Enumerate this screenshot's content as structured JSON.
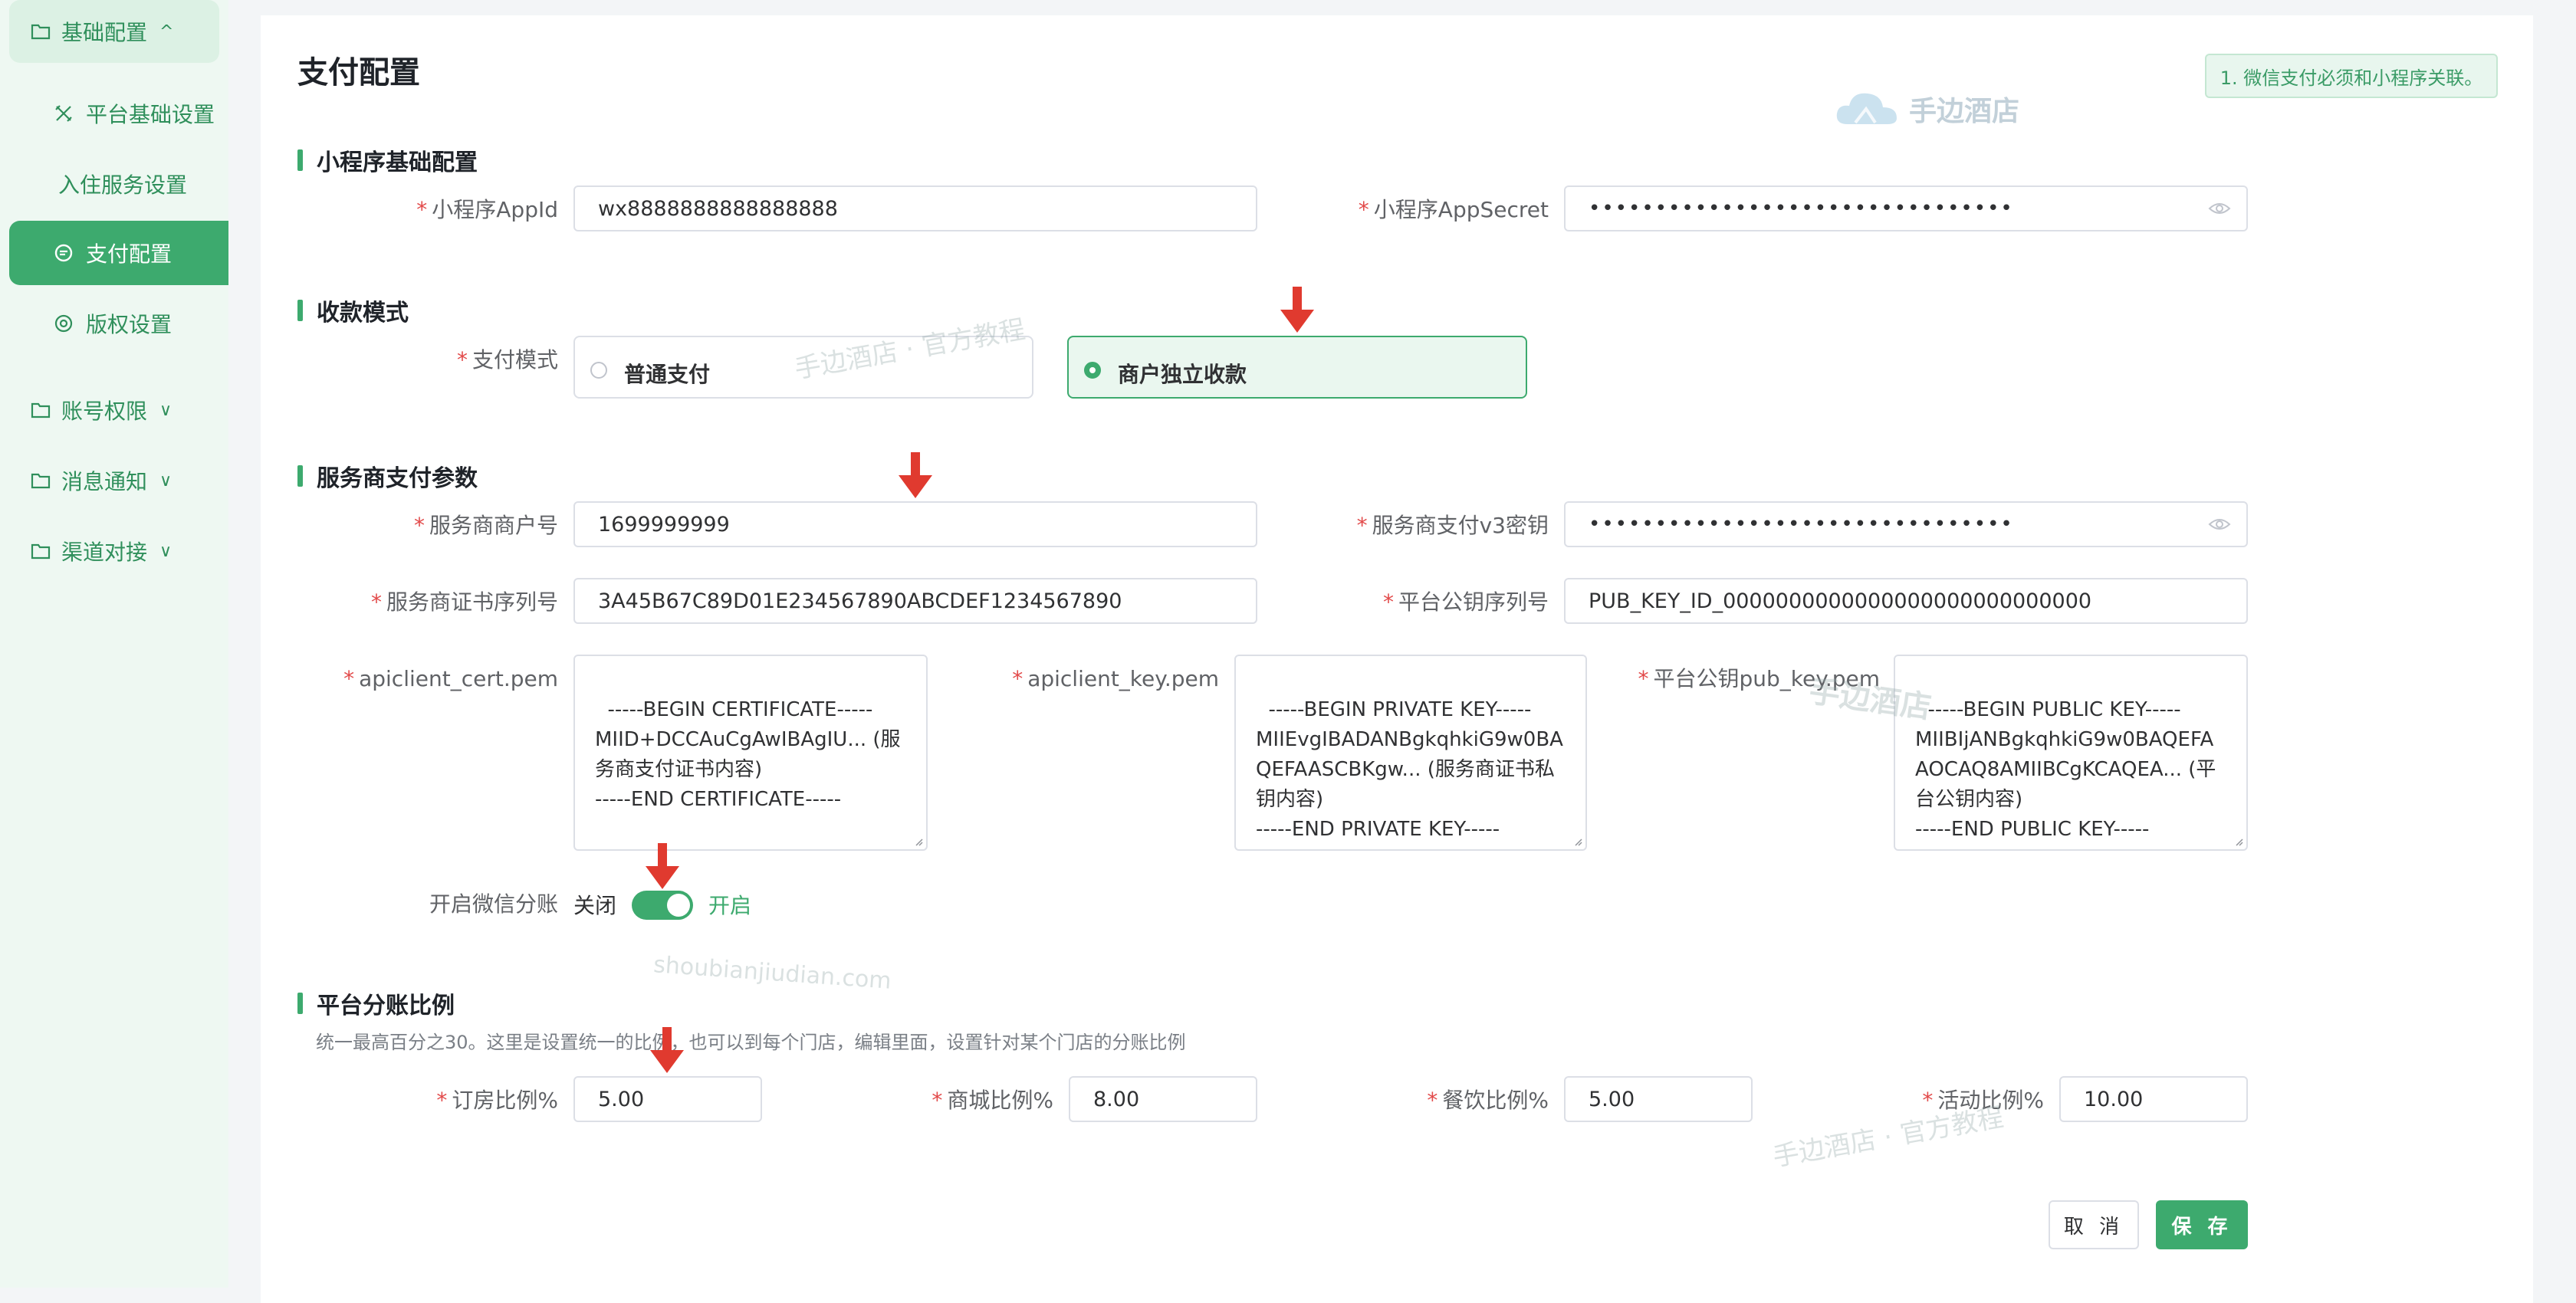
{
  "sidebar": {
    "groups": [
      {
        "label": "基础配置",
        "chevron": "^",
        "icon": "folder-icon"
      },
      {
        "label": "账号权限",
        "chevron": "∨",
        "icon": "folder-icon"
      },
      {
        "label": "消息通知",
        "chevron": "∨",
        "icon": "folder-icon"
      },
      {
        "label": "渠道对接",
        "chevron": "∨",
        "icon": "folder-icon"
      }
    ],
    "items": [
      {
        "label": "平台基础设置",
        "icon": "tools-icon"
      },
      {
        "label": "入住服务设置",
        "icon": ""
      },
      {
        "label": "支付配置",
        "icon": "payment-icon",
        "active": true
      },
      {
        "label": "版权设置",
        "icon": "copyright-icon"
      }
    ]
  },
  "page": {
    "title": "支付配置",
    "tip": "1. 微信支付必须和小程序关联。"
  },
  "sections": {
    "miniapp": "小程序基础配置",
    "mode": "收款模式",
    "provider": "服务商支付参数",
    "share": "平台分账比例"
  },
  "miniapp": {
    "appid_label": "小程序AppId",
    "appid_value": "wx8888888888888888",
    "secret_label": "小程序AppSecret",
    "secret_value": "••••••••••••••••••••••••••••••••"
  },
  "mode": {
    "label": "支付模式",
    "options": [
      "普通支付",
      "商户独立收款"
    ],
    "selected": "商户独立收款"
  },
  "provider": {
    "mchid_label": "服务商商户号",
    "mchid_value": "1699999999",
    "v3key_label": "服务商支付v3密钥",
    "v3key_value": "••••••••••••••••••••••••••••••••",
    "serial_label": "服务商证书序列号",
    "serial_value": "3A45B67C89D01E234567890ABCDEF1234567890",
    "pubkey_serial_label": "平台公钥序列号",
    "pubkey_serial_value": "PUB_KEY_ID_0000000000000000000000000000",
    "cert_label": "apiclient_cert.pem",
    "cert_value": "-----BEGIN CERTIFICATE-----\nMIID+DCCAuCgAwIBAgIU... (服务商支付证书内容)\n-----END CERTIFICATE-----",
    "key_label": "apiclient_key.pem",
    "key_value": "-----BEGIN PRIVATE KEY-----\nMIIEvgIBADANBgkqhkiG9w0BAQEFAASCBKgw... (服务商证书私钥内容)\n-----END PRIVATE KEY-----",
    "pub_label": "平台公钥pub_key.pem",
    "pub_value": "-----BEGIN PUBLIC KEY-----\nMIIBIjANBgkqhkiG9w0BAQEFAAOCAQ8AMIIBCgKCAQEA... (平台公钥内容)\n-----END PUBLIC KEY-----",
    "split_label": "开启微信分账",
    "split_off": "关闭",
    "split_on": "开启",
    "split_enabled": true
  },
  "share": {
    "hint": "统一最高百分之30。这里是设置统一的比例，也可以到每个门店，编辑里面，设置针对某个门店的分账比例",
    "room_label": "订房比例%",
    "room_value": "5.00",
    "mall_label": "商城比例%",
    "mall_value": "8.00",
    "food_label": "餐饮比例%",
    "food_value": "5.00",
    "event_label": "活动比例%",
    "event_value": "10.00"
  },
  "buttons": {
    "cancel": "取 消",
    "save": "保 存"
  },
  "watermarks": {
    "logo": "手边酒店",
    "wm1": "手边酒店 · 官方教程",
    "wm2": "shoubianjiudian.com",
    "wm3": "手边酒店 · 官方教程",
    "wm4": "手边酒店"
  },
  "colors": {
    "accent": "#3daa6e",
    "required": "#e24a4a",
    "arrow": "#e03a2f"
  }
}
